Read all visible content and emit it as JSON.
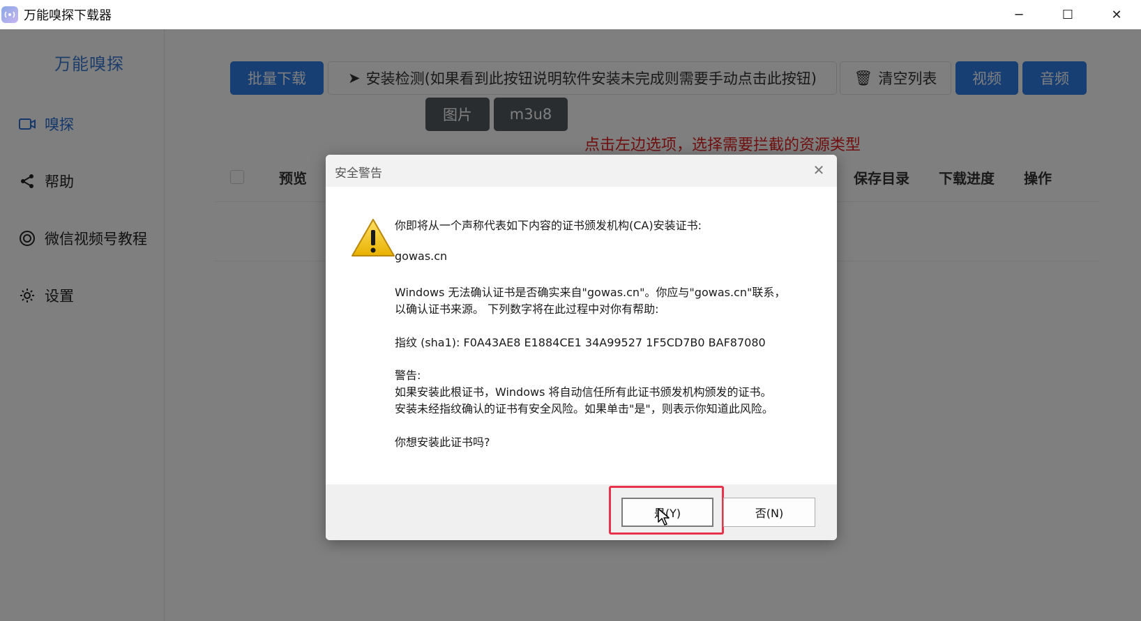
{
  "window": {
    "title": "万能嗅探下载器",
    "controls": {
      "minimize": "─",
      "maximize": "☐",
      "close": "✕"
    }
  },
  "sidebar": {
    "brand": "万能嗅探",
    "items": [
      {
        "label": "嗅探",
        "icon": "camera-icon",
        "active": true
      },
      {
        "label": "帮助",
        "icon": "share-icon",
        "active": false
      },
      {
        "label": "微信视频号教程",
        "icon": "lifebuoy-icon",
        "active": false
      },
      {
        "label": "设置",
        "icon": "gear-icon",
        "active": false
      }
    ]
  },
  "toolbar": {
    "batch_download": "批量下载",
    "install_check": "安装检测(如果看到此按钮说明软件安装未完成则需要手动点击此按钮)",
    "clear_list": "清空列表",
    "video": "视频",
    "audio": "音频",
    "image": "图片",
    "m3u8": "m3u8",
    "hint": "点击左边选项，选择需要拦截的资源类型"
  },
  "table": {
    "headers": [
      "预览",
      "保存目录",
      "下载进度",
      "操作"
    ]
  },
  "dialog": {
    "title": "安全警告",
    "close": "✕",
    "lines": {
      "intro": "你即将从一个声称代表如下内容的证书颁发机构(CA)安装证书:",
      "domain": "gowas.cn",
      "confirm1": "Windows 无法确认证书是否确实来自\"gowas.cn\"。你应与\"gowas.cn\"联系，",
      "confirm2": "以确认证书来源。 下列数字将在此过程中对你有帮助:",
      "thumbprint": "指纹 (sha1): F0A43AE8 E1884CE1 34A99527 1F5CD7B0 BAF87080",
      "warning_label": "警告:",
      "warning1": "如果安装此根证书，Windows 将自动信任所有此证书颁发机构颁发的证书。",
      "warning2": "安装未经指纹确认的证书有安全风险。如果单击\"是\"，则表示你知道此风险。",
      "question": "你想安装此证书吗?"
    },
    "yes": "是(Y)",
    "no": "否(N)"
  },
  "colors": {
    "primary": "#2f7ee8",
    "hint": "#e02020",
    "highlight": "#e8334a"
  }
}
